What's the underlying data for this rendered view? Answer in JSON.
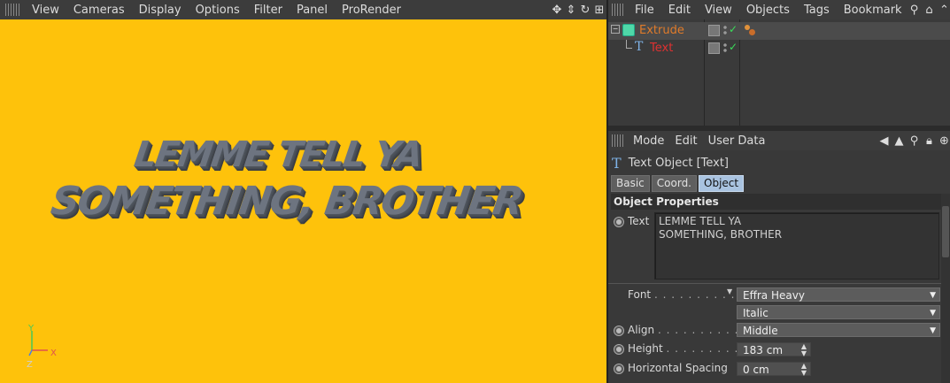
{
  "viewport": {
    "menu": [
      "View",
      "Cameras",
      "Display",
      "Options",
      "Filter",
      "Panel",
      "ProRender"
    ],
    "text_lines": [
      "LEMME TELL YA",
      "SOMETHING, BROTHER"
    ],
    "axes": {
      "y": "Y",
      "x": "X",
      "z": "Z"
    },
    "tool_icons": [
      "move-view-icon",
      "zoom-view-icon",
      "rotate-view-icon",
      "maximize-view-icon"
    ],
    "colors": {
      "background": "#fec20b",
      "text": "#6d7480",
      "extrusion": "#454a51"
    }
  },
  "object_manager": {
    "menu": [
      "File",
      "Edit",
      "View",
      "Objects",
      "Tags",
      "Bookmark"
    ],
    "tool_icons": [
      "search-icon",
      "home-icon",
      "chevron-up-icon"
    ],
    "objects": [
      {
        "name": "Extrude",
        "color": "#e07b2a",
        "icon": "extrude-icon",
        "selected": true
      },
      {
        "name": "Text",
        "color": "#e03131",
        "icon": "text-spline-icon",
        "selected": false
      }
    ]
  },
  "attribute_manager": {
    "menu": [
      "Mode",
      "Edit",
      "User Data"
    ],
    "object_title": "Text Object [Text]",
    "tabs": [
      "Basic",
      "Coord.",
      "Object"
    ],
    "active_tab": "Object",
    "section_title": "Object Properties",
    "text_label": "Text",
    "text_value_lines": [
      "LEMME TELL YA",
      "SOMETHING, BROTHER"
    ],
    "font_label": "Font",
    "font_dots": ". . . . . . . . . . . . .",
    "font_family": "Effra Heavy",
    "font_style": "Italic",
    "align_label": "Align",
    "align_dots": ". . . . . . . . . . . . .",
    "align_value": "Middle",
    "height_label": "Height",
    "height_dots": ". . . . . . . . . . . .",
    "height_value": "183 cm",
    "hspacing_label": "Horizontal Spacing",
    "hspacing_value": "0 cm"
  }
}
